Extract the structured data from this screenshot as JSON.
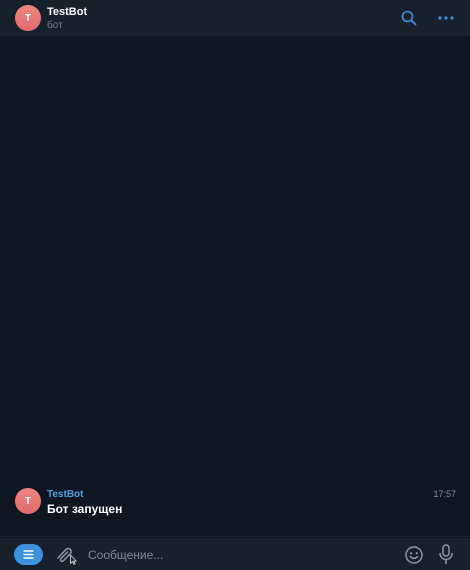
{
  "header": {
    "avatar_letter": "T",
    "title": "TestBot",
    "subtitle": "бот",
    "search_icon": "search-icon",
    "more_icon": "more-horizontal-icon"
  },
  "messages": [
    {
      "avatar_letter": "T",
      "author": "TestBot",
      "text": "Бот запущен",
      "time": "17:57"
    }
  ],
  "composer": {
    "menu_icon": "bot-menu-icon",
    "attach_icon": "paperclip-icon",
    "placeholder": "Сообщение...",
    "value": "",
    "emoji_icon": "emoji-icon",
    "mic_icon": "microphone-icon"
  },
  "colors": {
    "header_bg": "#17212b",
    "chat_bg": "#0e1621",
    "accent": "#3d92e0",
    "author": "#4ba3e2",
    "avatar": "#ee7d7a",
    "muted": "#7d8b99"
  }
}
